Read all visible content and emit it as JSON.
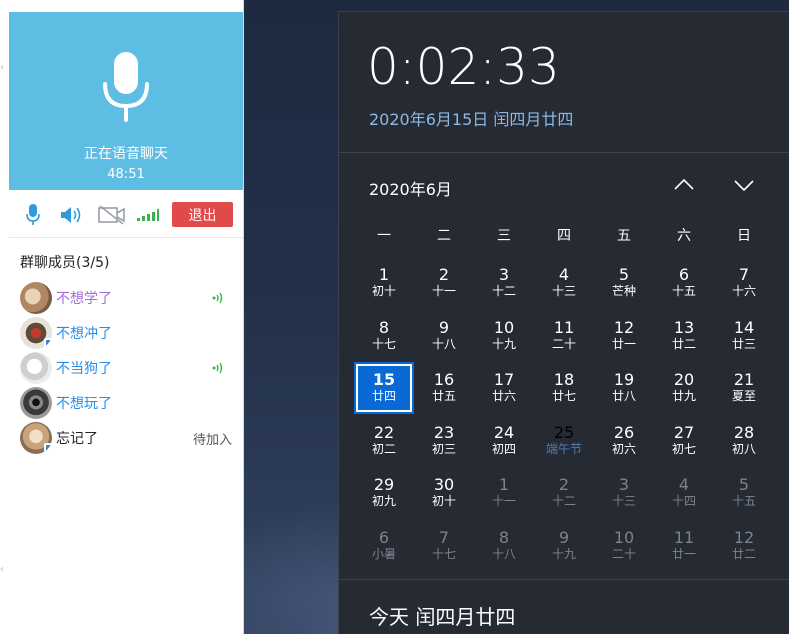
{
  "chat": {
    "voice_status": "正在语音聊天",
    "voice_timer": "48:51",
    "exit_label": "退出",
    "members_title": "群聊成员(3/5)",
    "members": [
      {
        "name": "不想学了",
        "color": "#a56ddb",
        "speaking": true,
        "mobile": false,
        "status": ""
      },
      {
        "name": "不想冲了",
        "color": "#2a8ee6",
        "speaking": false,
        "mobile": true,
        "status": ""
      },
      {
        "name": "不当狗了",
        "color": "#2a8ee6",
        "speaking": true,
        "mobile": false,
        "status": ""
      },
      {
        "name": "不想玩了",
        "color": "#2a8ee6",
        "speaking": false,
        "mobile": false,
        "status": ""
      },
      {
        "name": "忘记了",
        "color": "#222222",
        "speaking": false,
        "mobile": true,
        "status": "待加入"
      }
    ],
    "accent": "#5ebde3",
    "exit_color": "#e04a4a"
  },
  "calendar": {
    "time": "0:02:33",
    "full_date": "2020年6月15日 闰四月廿四",
    "month_title": "2020年6月",
    "weekdays": [
      "一",
      "二",
      "三",
      "四",
      "五",
      "六",
      "日"
    ],
    "days": [
      {
        "day": "1",
        "lunar": "初十",
        "type": "cur"
      },
      {
        "day": "2",
        "lunar": "十一",
        "type": "cur"
      },
      {
        "day": "3",
        "lunar": "十二",
        "type": "cur"
      },
      {
        "day": "4",
        "lunar": "十三",
        "type": "cur"
      },
      {
        "day": "5",
        "lunar": "芒种",
        "type": "cur"
      },
      {
        "day": "6",
        "lunar": "十五",
        "type": "cur"
      },
      {
        "day": "7",
        "lunar": "十六",
        "type": "cur"
      },
      {
        "day": "8",
        "lunar": "十七",
        "type": "cur"
      },
      {
        "day": "9",
        "lunar": "十八",
        "type": "cur"
      },
      {
        "day": "10",
        "lunar": "十九",
        "type": "cur"
      },
      {
        "day": "11",
        "lunar": "二十",
        "type": "cur"
      },
      {
        "day": "12",
        "lunar": "廿一",
        "type": "cur"
      },
      {
        "day": "13",
        "lunar": "廿二",
        "type": "cur"
      },
      {
        "day": "14",
        "lunar": "廿三",
        "type": "cur"
      },
      {
        "day": "15",
        "lunar": "廿四",
        "type": "today"
      },
      {
        "day": "16",
        "lunar": "廿五",
        "type": "cur"
      },
      {
        "day": "17",
        "lunar": "廿六",
        "type": "cur"
      },
      {
        "day": "18",
        "lunar": "廿七",
        "type": "cur"
      },
      {
        "day": "19",
        "lunar": "廿八",
        "type": "cur"
      },
      {
        "day": "20",
        "lunar": "廿九",
        "type": "cur"
      },
      {
        "day": "21",
        "lunar": "夏至",
        "type": "cur"
      },
      {
        "day": "22",
        "lunar": "初二",
        "type": "cur"
      },
      {
        "day": "23",
        "lunar": "初三",
        "type": "cur"
      },
      {
        "day": "24",
        "lunar": "初四",
        "type": "cur"
      },
      {
        "day": "25",
        "lunar": "端午节",
        "type": "fest"
      },
      {
        "day": "26",
        "lunar": "初六",
        "type": "cur"
      },
      {
        "day": "27",
        "lunar": "初七",
        "type": "cur"
      },
      {
        "day": "28",
        "lunar": "初八",
        "type": "cur"
      },
      {
        "day": "29",
        "lunar": "初九",
        "type": "cur"
      },
      {
        "day": "30",
        "lunar": "初十",
        "type": "cur"
      },
      {
        "day": "1",
        "lunar": "十一",
        "type": "oth"
      },
      {
        "day": "2",
        "lunar": "十二",
        "type": "oth"
      },
      {
        "day": "3",
        "lunar": "十三",
        "type": "oth"
      },
      {
        "day": "4",
        "lunar": "十四",
        "type": "oth"
      },
      {
        "day": "5",
        "lunar": "十五",
        "type": "oth"
      },
      {
        "day": "6",
        "lunar": "小暑",
        "type": "oth"
      },
      {
        "day": "7",
        "lunar": "十七",
        "type": "oth"
      },
      {
        "day": "8",
        "lunar": "十八",
        "type": "oth"
      },
      {
        "day": "9",
        "lunar": "十九",
        "type": "oth"
      },
      {
        "day": "10",
        "lunar": "二十",
        "type": "oth"
      },
      {
        "day": "11",
        "lunar": "廿一",
        "type": "oth"
      },
      {
        "day": "12",
        "lunar": "廿二",
        "type": "oth"
      }
    ],
    "today_lunar": "今天 闰四月廿四",
    "accent": "#0a69d4"
  }
}
